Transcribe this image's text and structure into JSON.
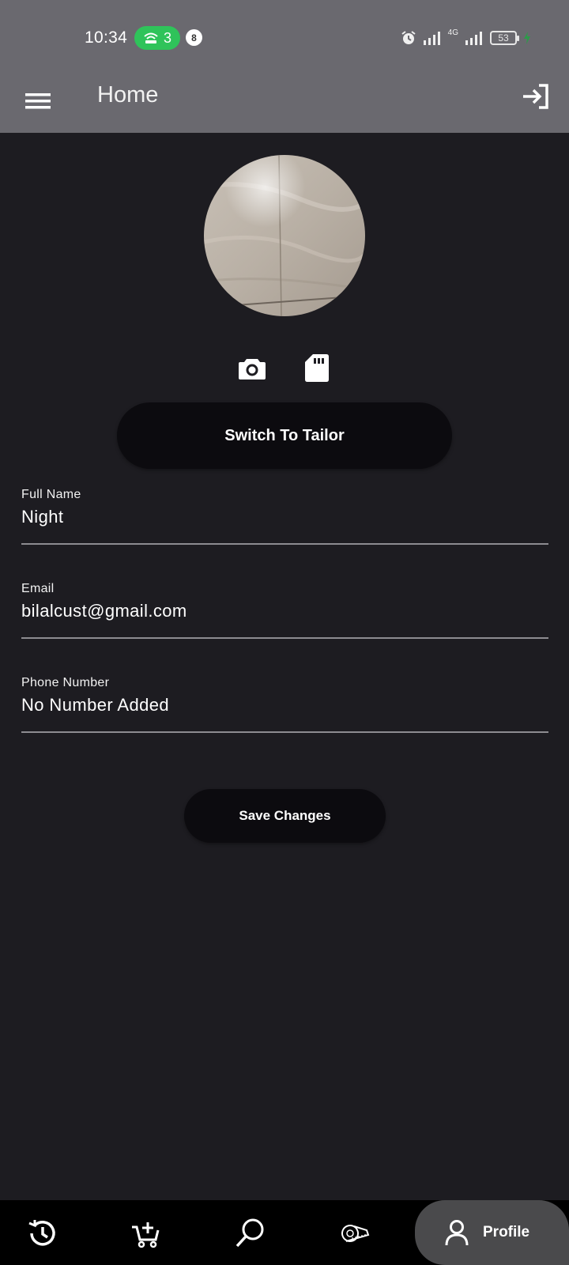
{
  "status_bar": {
    "time": "10:34",
    "hotspot_count": "3",
    "notification_count": "8",
    "network_label": "4G",
    "battery_level": "53",
    "hotspot_color": "#2fc35a"
  },
  "app_bar": {
    "title": "Home",
    "menu_icon": "hamburger-menu-icon",
    "action_icon": "login-icon",
    "background": "#6a696f"
  },
  "profile": {
    "photo_actions": [
      "camera-icon",
      "sd-card-icon"
    ],
    "switch_label": "Switch To Tailor",
    "fields": [
      {
        "label": "Full Name",
        "value": "Night"
      },
      {
        "label": "Email",
        "value": "bilalcust@gmail.com"
      },
      {
        "label": "Phone Number",
        "value": "No Number Added"
      }
    ],
    "save_label": "Save Changes"
  },
  "bottom_nav": {
    "items": [
      "history-icon",
      "add-to-cart-icon",
      "search-icon",
      "measuring-tape-icon"
    ],
    "active_label": "Profile",
    "active_icon": "person-icon"
  }
}
